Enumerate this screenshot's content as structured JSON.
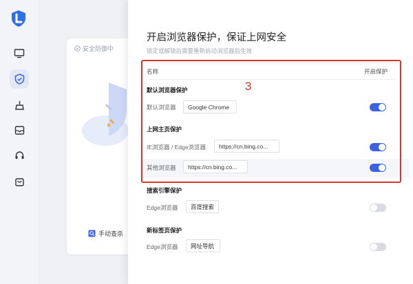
{
  "background": {
    "status_text": "安全防御中",
    "manual_check_label": "手动查杀"
  },
  "colors": {
    "accent": "#3b62e0",
    "annotation_red": "#d9342b",
    "toggle_off": "#d9dbe0"
  },
  "panel": {
    "title": "开启浏览器保护，保证上网安全",
    "subtitle": "锁定或解锁后需要重新启动浏览器后生效",
    "header_name": "名称",
    "header_protect": "开启保护",
    "annotation": "3",
    "sections": [
      {
        "title": "默认浏览器保护",
        "rows": [
          {
            "label": "默认浏览器",
            "value": "Google Chrome",
            "enabled": true
          }
        ]
      },
      {
        "title": "上网主页保护",
        "rows": [
          {
            "label": "IE浏览器 / Edge浏览器",
            "value": "https://cn.bing.co...",
            "enabled": true
          },
          {
            "label": "其他浏览器",
            "value": "https://cn.bing.co...",
            "enabled": true
          }
        ]
      },
      {
        "title": "搜索引擎保护",
        "rows": [
          {
            "label": "Edge浏览器",
            "value": "百度搜索",
            "enabled": false
          }
        ]
      },
      {
        "title": "新标签页保护",
        "rows": [
          {
            "label": "Edge浏览器",
            "value": "网址导航",
            "enabled": false
          }
        ]
      }
    ]
  },
  "sidebar_icons": [
    "logo-icon",
    "monitor-icon",
    "shield-check-icon",
    "broom-icon",
    "toolbox-icon",
    "headset-icon",
    "bag-icon"
  ]
}
